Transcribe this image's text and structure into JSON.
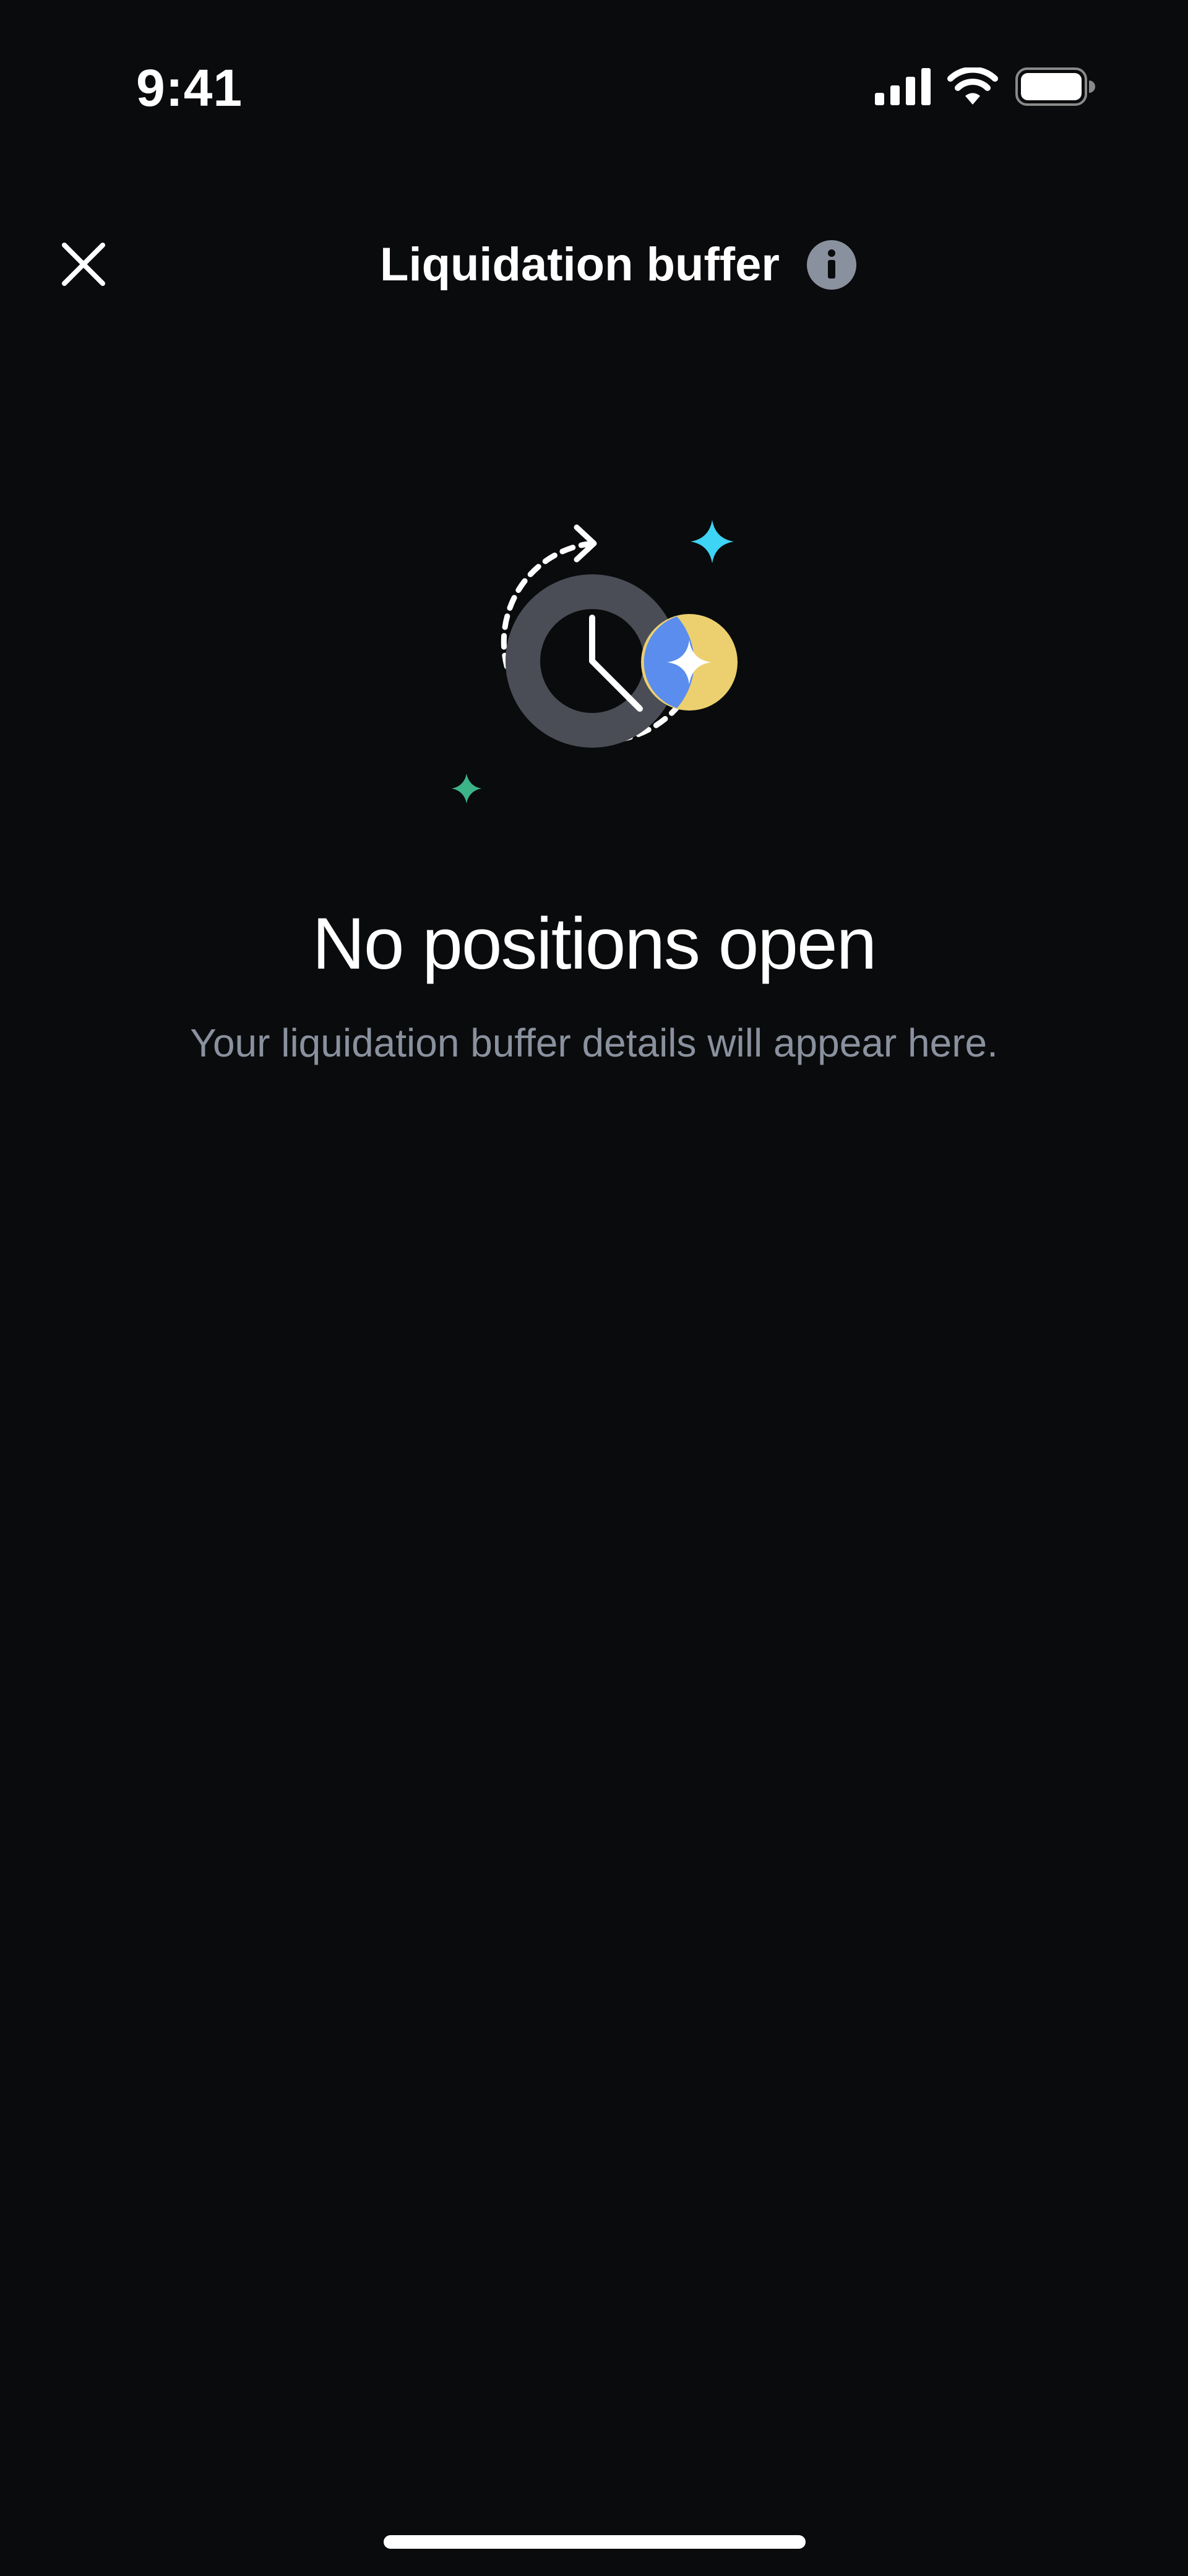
{
  "status_bar": {
    "time": "9:41",
    "icons": [
      "cellular-signal-icon",
      "wifi-icon",
      "battery-icon"
    ]
  },
  "header": {
    "title": "Liquidation buffer",
    "close_icon": "close-icon",
    "info_icon": "info-icon"
  },
  "empty_state": {
    "illustration": "clock-cycle-illustration",
    "title": "No positions open",
    "subtitle": "Your liquidation buffer details will appear here."
  },
  "colors": {
    "background": "#0a0b0d",
    "text_primary": "#ffffff",
    "text_secondary": "#8a919e",
    "info_icon_bg": "#8a919e",
    "clock_ring": "#4a4d55",
    "coin_yellow": "#ecd06f",
    "coin_blue": "#5b8def",
    "sparkle_cyan": "#3ed4f5",
    "sparkle_green": "#3db38a"
  }
}
